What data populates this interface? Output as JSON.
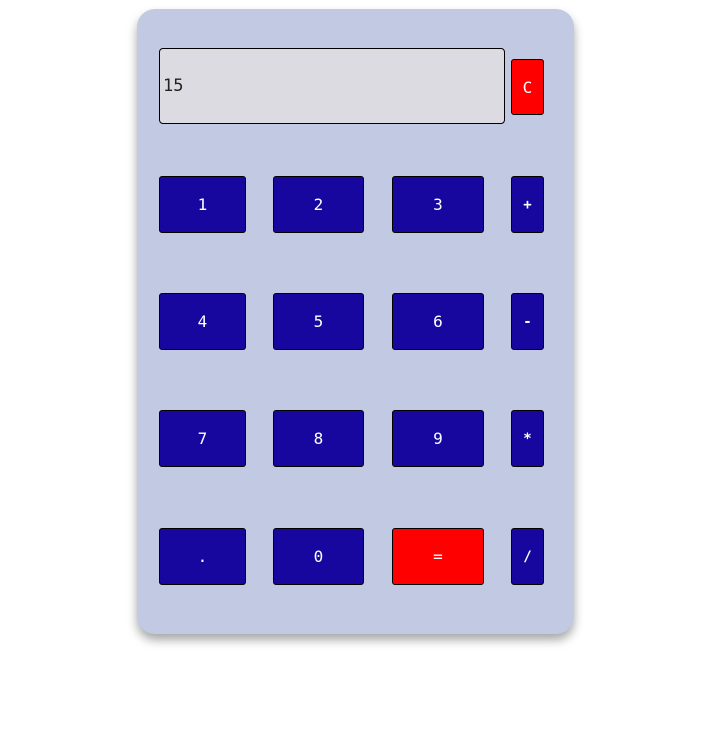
{
  "display": {
    "value": "15"
  },
  "keys": {
    "clear": "C",
    "rows": [
      [
        "1",
        "2",
        "3",
        "+"
      ],
      [
        "4",
        "5",
        "6",
        "-"
      ],
      [
        "7",
        "8",
        "9",
        "*"
      ],
      [
        ".",
        "0",
        "=",
        "/"
      ]
    ]
  },
  "colors": {
    "body": "#c2c9e3",
    "key": "#17079f",
    "accent": "#ff0000",
    "display": "#dcdbe1"
  }
}
